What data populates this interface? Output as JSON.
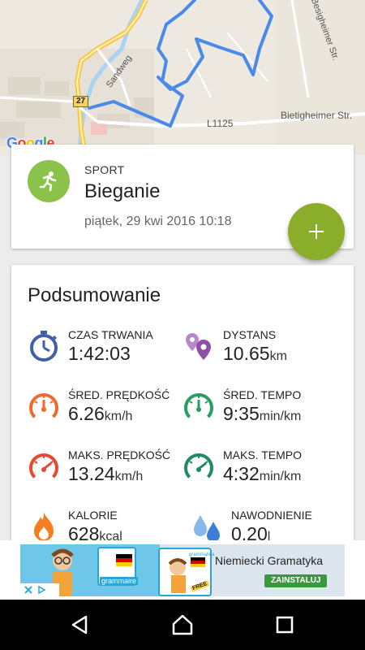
{
  "map": {
    "labels": {
      "sandweg": "Sandweg",
      "l1125": "L1125",
      "bietigheimer": "Bietigheimer Str.",
      "besigheimer": "Besigheimer Str.",
      "route27": "27"
    },
    "google": [
      "G",
      "o",
      "o",
      "g",
      "l",
      "e"
    ],
    "google_colors": [
      "#4285f4",
      "#ea4335",
      "#fbbc05",
      "#4285f4",
      "#34a853",
      "#ea4335"
    ],
    "route_color": "#4a8ae8"
  },
  "sport": {
    "category_label": "SPORT",
    "name": "Bieganie",
    "datetime": "piątek, 29 kwi 2016 10:18",
    "icon": "running-person-icon",
    "icon_color": "#8bc34a"
  },
  "fab": {
    "icon": "plus-icon",
    "color": "#8aad2a"
  },
  "summary": {
    "title": "Podsumowanie",
    "metrics": [
      {
        "label": "CZAS TRWANIA",
        "value": "1:42:03",
        "unit": "",
        "icon": "stopwatch-icon",
        "color": "#3f5fa8"
      },
      {
        "label": "DYSTANS",
        "value": "10.65",
        "unit": "km",
        "icon": "map-pins-icon",
        "color": "#8e4fa6"
      },
      {
        "label": "ŚRED. PRĘDKOŚĆ",
        "value": "6.26",
        "unit": "km/h",
        "icon": "speedometer-icon",
        "color": "#ef6a2e"
      },
      {
        "label": "ŚRED. TEMPO",
        "value": "9:35",
        "unit": "min/km",
        "icon": "speedometer-icon",
        "color": "#2a9d63"
      },
      {
        "label": "MAKS. PRĘDKOŚĆ",
        "value": "13.24",
        "unit": "km/h",
        "icon": "speedometer-icon",
        "color": "#e6492d"
      },
      {
        "label": "MAKS. TEMPO",
        "value": "4:32",
        "unit": "min/km",
        "icon": "speedometer-icon",
        "color": "#1f8a63"
      },
      {
        "label": "KALORIE",
        "value": "628",
        "unit": "kcal",
        "icon": "flame-icon",
        "color": "#f57c1f"
      },
      {
        "label": "NAWODNIENIE",
        "value": "0.20",
        "unit": "l",
        "icon": "water-drops-icon",
        "color": "#4a90e2"
      }
    ]
  },
  "ad": {
    "brand": "grammaire",
    "brand_small": "grammatica",
    "free_badge": "FREE",
    "title": "Niemiecki Gramatyka",
    "button": "ZAINSTALUJ"
  },
  "navbar": {
    "back": "back-icon",
    "home": "home-icon",
    "recents": "recents-icon"
  }
}
